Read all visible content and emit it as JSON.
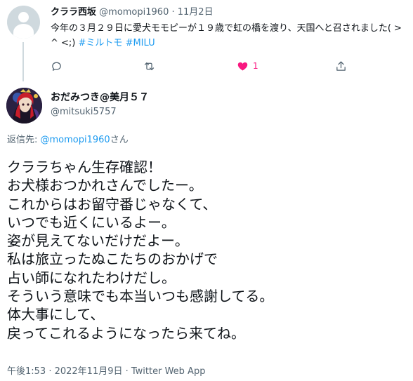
{
  "parent_tweet": {
    "author_name": "クララ西坂",
    "author_handle": "@momopi1960",
    "separator": "·",
    "date": "11月2日",
    "text": "今年の３月２９日に愛犬モモピーが１９歳で虹の橋を渡り、天国へと召されました( > ^ <;) ",
    "hashtags": [
      "#ミルトモ",
      "#MILU"
    ],
    "like_count": "1",
    "icons": [
      "reply-icon",
      "retweet-icon",
      "like-icon",
      "share-icon"
    ],
    "like_color": "#f91880"
  },
  "reply_tweet": {
    "author_name": "おだみつき@美月５７",
    "author_handle": "@mitsuki5757",
    "reply_prefix": "返信先: ",
    "reply_mention": "@momopi1960",
    "reply_suffix": "さん",
    "text": "クララちゃん生存確認！\nお犬様おつかれさんでしたー。\nこれからはお留守番じゃなくて、\nいつでも近くにいるよー。\n姿が見えてないだけだよー。\n私は旅立ったぬこたちのおかげで\n占い師になれたわけだし。\nそういう意味でも本当いつも感謝してる。\n体大事にして、\n戻ってこれるようになったら来てね。",
    "timestamp": "午後1:53 · 2022年11月9日 · Twitter Web App"
  },
  "colors": {
    "accent": "#1d9bf0",
    "secondary_text": "#536471",
    "primary_text": "#0f1419"
  }
}
